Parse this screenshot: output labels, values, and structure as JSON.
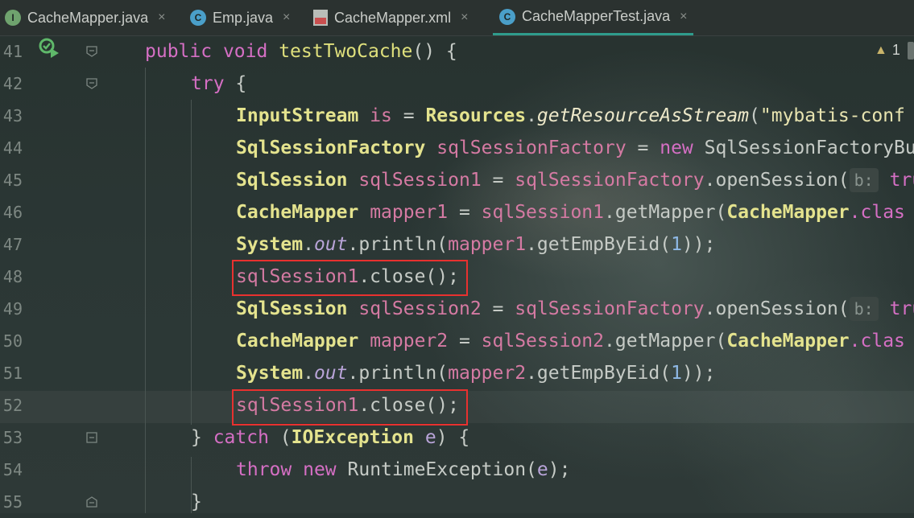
{
  "tabs": [
    {
      "label": "CacheMapper.java",
      "icon": "interface-icon",
      "icon_letter": "I",
      "icon_color": "#6fa36e"
    },
    {
      "label": "Emp.java",
      "icon": "class-icon",
      "icon_letter": "C",
      "icon_color": "#4a9fc9"
    },
    {
      "label": "CacheMapper.xml",
      "icon": "xml-file-icon"
    },
    {
      "label": "CacheMapperTest.java",
      "icon": "test-class-icon",
      "icon_letter": "C",
      "icon_color": "#4a9fc9",
      "active": true
    }
  ],
  "close_glyph": "×",
  "warnings": {
    "icon": "warning-triangle-icon",
    "count": "1"
  },
  "lines": [
    {
      "num": "41"
    },
    {
      "num": "42"
    },
    {
      "num": "43"
    },
    {
      "num": "44"
    },
    {
      "num": "45"
    },
    {
      "num": "46"
    },
    {
      "num": "47"
    },
    {
      "num": "48"
    },
    {
      "num": "49"
    },
    {
      "num": "50"
    },
    {
      "num": "51"
    },
    {
      "num": "52"
    },
    {
      "num": "53"
    },
    {
      "num": "54"
    },
    {
      "num": "55"
    }
  ],
  "code": {
    "l41": {
      "kw1": "public",
      "kw2": "void",
      "name": "testTwoCache",
      "rest": "() {"
    },
    "l42": {
      "kw": "try",
      "rest": " {"
    },
    "l43": {
      "type": "InputStream",
      "var": "is",
      "eq": " = ",
      "cls": "Resources",
      "dot": ".",
      "method": "getResourceAsStream",
      "open": "(",
      "str": "\"mybatis-conf"
    },
    "l44": {
      "type": "SqlSessionFactory",
      "var": "sqlSessionFactory",
      "eq": " = ",
      "kw": "new",
      "rest": " SqlSessionFactoryBu"
    },
    "l45": {
      "type": "SqlSession",
      "var": "sqlSession1",
      "eq": " = ",
      "obj": "sqlSessionFactory",
      "call": ".openSession(",
      "hint": "b:",
      "tail": "tru"
    },
    "l46": {
      "type": "CacheMapper",
      "var": "mapper1",
      "eq": " = ",
      "obj": "sqlSession1",
      "call": ".getMapper(",
      "cls": "CacheMapper",
      "tail": ".clas"
    },
    "l47": {
      "cls": "System",
      "dot": ".",
      "field": "out",
      "call": ".println(",
      "obj": "mapper1",
      "call2": ".getEmpByEid(",
      "num": "1",
      "end": "));"
    },
    "l48": {
      "obj": "sqlSession1",
      "call": ".close();"
    },
    "l49": {
      "type": "SqlSession",
      "var": "sqlSession2",
      "eq": " = ",
      "obj": "sqlSessionFactory",
      "call": ".openSession(",
      "hint": "b:",
      "tail": "tru"
    },
    "l50": {
      "type": "CacheMapper",
      "var": "mapper2",
      "eq": " = ",
      "obj": "sqlSession2",
      "call": ".getMapper(",
      "cls": "CacheMapper",
      "tail": ".clas"
    },
    "l51": {
      "cls": "System",
      "dot": ".",
      "field": "out",
      "call": ".println(",
      "obj": "mapper2",
      "call2": ".getEmpByEid(",
      "num": "1",
      "end": "));"
    },
    "l52": {
      "obj": "sqlSession1",
      "call": ".close();"
    },
    "l53": {
      "pre": "} ",
      "kw": "catch",
      "open": " (",
      "cls": "IOException",
      "var": "e",
      "rest": ") {"
    },
    "l54": {
      "kw1": "throw",
      "kw2": "new",
      "rest": " RuntimeException(",
      "var": "e",
      "end": ");"
    },
    "l55": {
      "rest": "}"
    }
  },
  "colors": {
    "keyword": "#d56fc4",
    "class": "#e4e38e",
    "variable": "#d57aa3",
    "highlight_box": "#e8312f",
    "active_tab_underline": "#2f9c8c"
  }
}
